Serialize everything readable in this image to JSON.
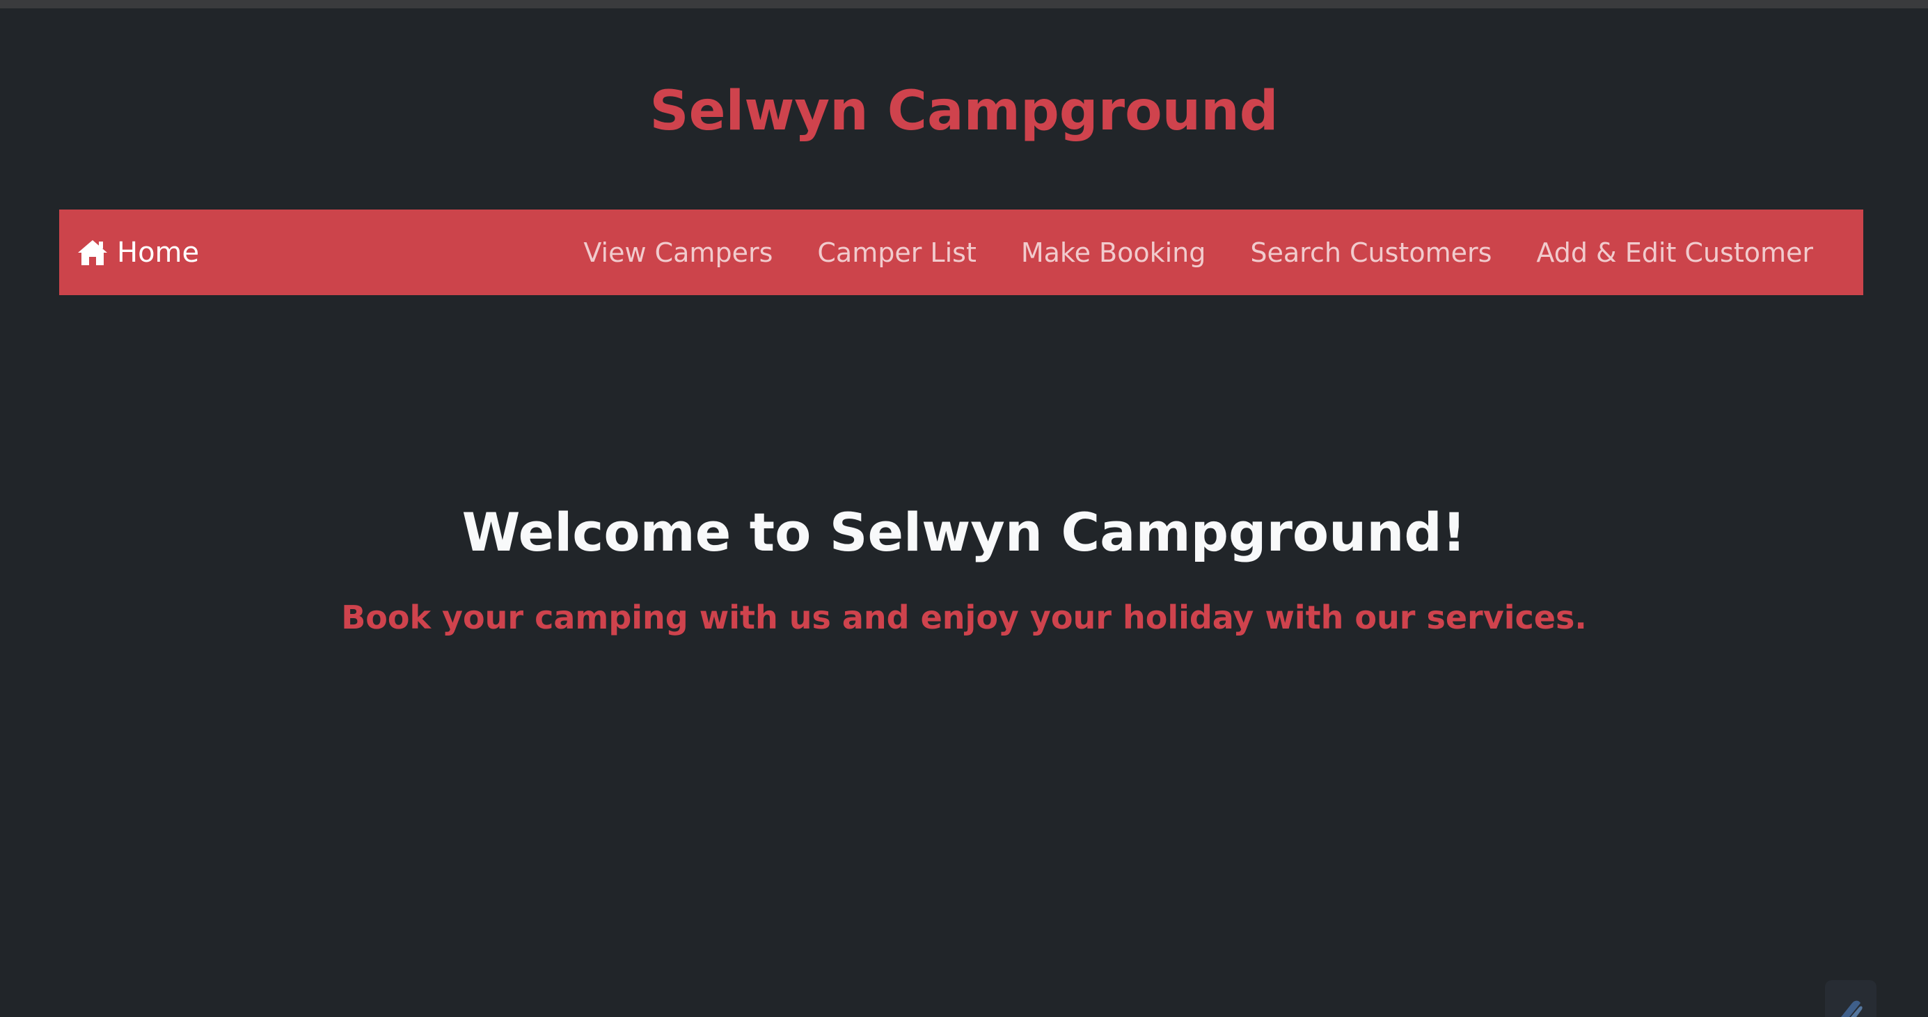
{
  "site": {
    "title": "Selwyn Campground"
  },
  "navbar": {
    "home_label": "Home",
    "home_icon": "home-icon",
    "links": [
      "View Campers",
      "Camper List",
      "Make Booking",
      "Search Customers",
      "Add & Edit Customer"
    ]
  },
  "hero": {
    "heading": "Welcome to Selwyn Campground!",
    "subheading": "Book your camping with us and enjoy your holiday with our services."
  },
  "colors": {
    "background": "#212529",
    "accent": "#cc444b",
    "title_red": "#cf434d",
    "heading_text": "#f8f9fa"
  }
}
